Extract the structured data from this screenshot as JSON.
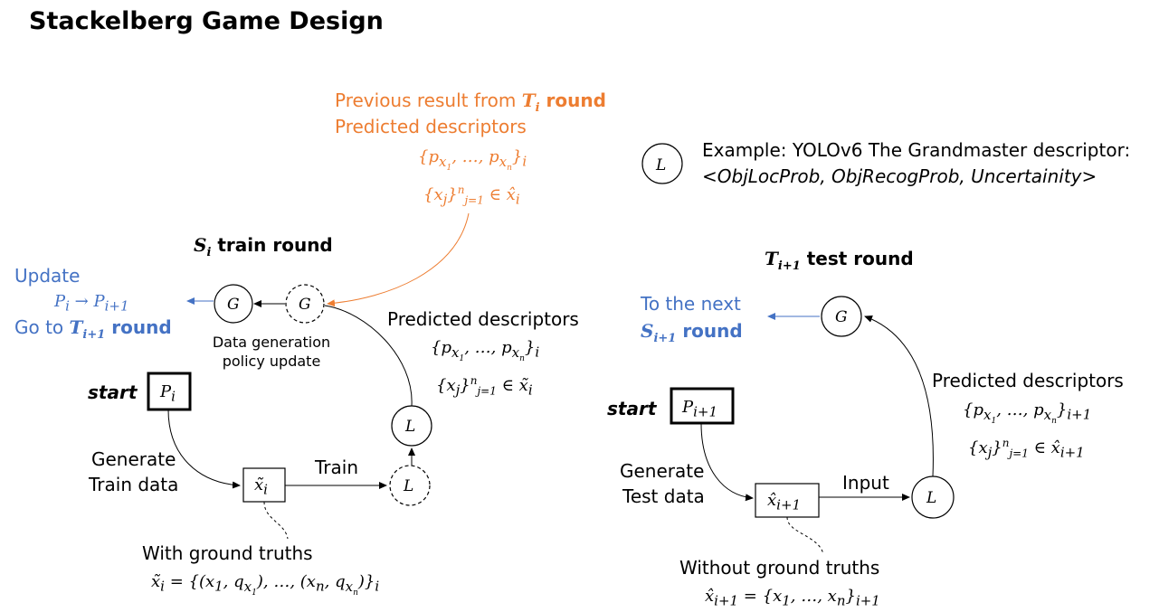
{
  "title": "Stackelberg Game Design",
  "colors": {
    "orange": "#ED7D31",
    "blue": "#4472C4",
    "black": "#000000"
  },
  "legend": {
    "node": "L",
    "line1": "Example: YOLOv6 The Grandmaster descriptor:",
    "line2": "<ObjLocProb, ObjRecogProb, Uncertainity>"
  },
  "previous": {
    "line1": "Previous result from",
    "round_sym": "T",
    "round_sub": "i",
    "round_word": "round",
    "line2": "Predicted descriptors",
    "set1": "{p_{x_1}, …, p_{x_n}}_i",
    "set2": "{x_j}_{j=1}^{n} ∈ x̂_i"
  },
  "train": {
    "heading_sym": "S",
    "heading_sub": "i",
    "heading_word": "train round",
    "update_label": "Update",
    "update_formula": "P_i → P_{i+1}",
    "goto_text": "Go to",
    "goto_sym": "T",
    "goto_sub": "i+1",
    "goto_word": "round",
    "g_node": "G",
    "g_dashed_node": "G",
    "policy_label": "Data generation policy update",
    "start_label": "start",
    "p_box": "P_i",
    "generate_label_1": "Generate",
    "generate_label_2": "Train data",
    "x_box": "x̃_i",
    "train_label": "Train",
    "l_dashed_node": "L",
    "l_node": "L",
    "pred_label": "Predicted descriptors",
    "pred_set1": "{p_{x_1}, …, p_{x_n}}_i",
    "pred_set2": "{x_j}_{j=1}^{n} ∈ x̃_i",
    "gt_label": "With ground truths",
    "gt_formula": "x̃_i = {(x_1, q_{x_1}), …, (x_n, q_{x_n})}_i"
  },
  "test": {
    "heading_sym": "T",
    "heading_sub": "i+1",
    "heading_word": "test round",
    "next_label": "To the next",
    "next_sym": "S",
    "next_sub": "i+1",
    "next_word": "round",
    "g_node": "G",
    "start_label": "start",
    "p_box": "P_{i+1}",
    "generate_label_1": "Generate",
    "generate_label_2": "Test data",
    "x_box": "x̂_{i+1}",
    "input_label": "Input",
    "l_node": "L",
    "pred_label": "Predicted descriptors",
    "pred_set1": "{p_{x_1}, …, p_{x_n}}_{i+1}",
    "pred_set2": "{x_j}_{j=1}^{n} ∈ x̂_{i+1}",
    "gt_label": "Without ground truths",
    "gt_formula": "x̂_{i+1} = {x_1, …, x_n}_{i+1}"
  }
}
